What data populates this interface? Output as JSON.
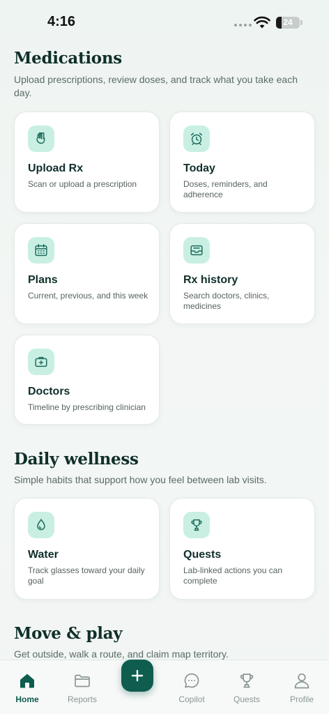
{
  "status": {
    "time": "4:16",
    "battery": "24",
    "battery_level": 0.24
  },
  "medications": {
    "title": "Medications",
    "subtitle": "Upload prescriptions, review doses, and track what you take each day.",
    "cards": [
      {
        "title": "Upload Rx",
        "desc": "Scan or upload a prescription",
        "icon": "hand-document-icon"
      },
      {
        "title": "Today",
        "desc": "Doses, reminders, and adherence",
        "icon": "alarm-clock-icon"
      },
      {
        "title": "Plans",
        "desc": "Current, previous, and this week",
        "icon": "calendar-icon"
      },
      {
        "title": "Rx history",
        "desc": "Search doctors, clinics, medicines",
        "icon": "archive-tray-icon"
      },
      {
        "title": "Doctors",
        "desc": "Timeline by prescribing clinician",
        "icon": "medical-kit-icon"
      }
    ]
  },
  "wellness": {
    "title": "Daily wellness",
    "subtitle": "Simple habits that support how you feel between lab visits.",
    "cards": [
      {
        "title": "Water",
        "desc": "Track glasses toward your daily goal",
        "icon": "water-drop-icon"
      },
      {
        "title": "Quests",
        "desc": "Lab-linked actions you can complete",
        "icon": "trophy-icon"
      }
    ]
  },
  "move": {
    "title": "Move & play",
    "subtitle": "Get outside, walk a route, and claim map territory."
  },
  "nav": {
    "items": [
      {
        "label": "Home",
        "icon": "home-icon",
        "active": true
      },
      {
        "label": "Reports",
        "icon": "folder-icon"
      },
      {
        "label": "Copilot",
        "icon": "chat-bubble-icon"
      },
      {
        "label": "Quests",
        "icon": "trophy-icon"
      },
      {
        "label": "Profile",
        "icon": "person-icon"
      }
    ],
    "fab_icon": "plus-icon"
  },
  "colors": {
    "accent": "#0e5d4f",
    "icon_bg": "#c9efe3",
    "text": "#0f2f2a"
  }
}
